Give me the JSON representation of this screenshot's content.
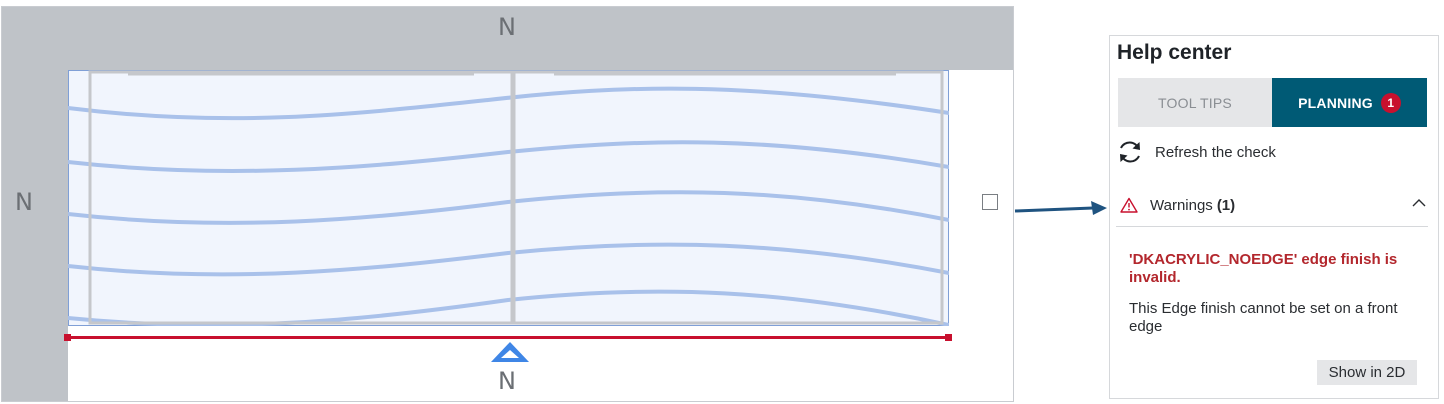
{
  "canvas": {
    "north_symbol": "N",
    "edge_color": "#c8102e",
    "wood_line_color": "#a9c1ea",
    "worktop_fill": "#f1f5fd",
    "wall_color": "#bfc3c8"
  },
  "help_center": {
    "title": "Help center",
    "tabs": [
      {
        "label": "TOOL TIPS",
        "active": false
      },
      {
        "label": "PLANNING",
        "active": true,
        "badge": "1"
      }
    ],
    "refresh_label": "Refresh the check",
    "warnings": {
      "label": "Warnings",
      "count": "(1)",
      "expanded": true,
      "items": [
        {
          "title": "'DKACRYLIC_NOEDGE' edge finish is invalid.",
          "description": "This Edge finish cannot be set on a front edge",
          "action_label": "Show in 2D"
        }
      ]
    },
    "accent_color": "#005a75",
    "badge_color": "#c8102e",
    "warning_color": "#b3272d"
  },
  "icons": {
    "refresh": "refresh-icon",
    "warning": "warning-triangle-icon",
    "chevron": "chevron-up-icon",
    "edge_arrow": "triangle-up-icon",
    "connector": "arrow-right-icon"
  }
}
